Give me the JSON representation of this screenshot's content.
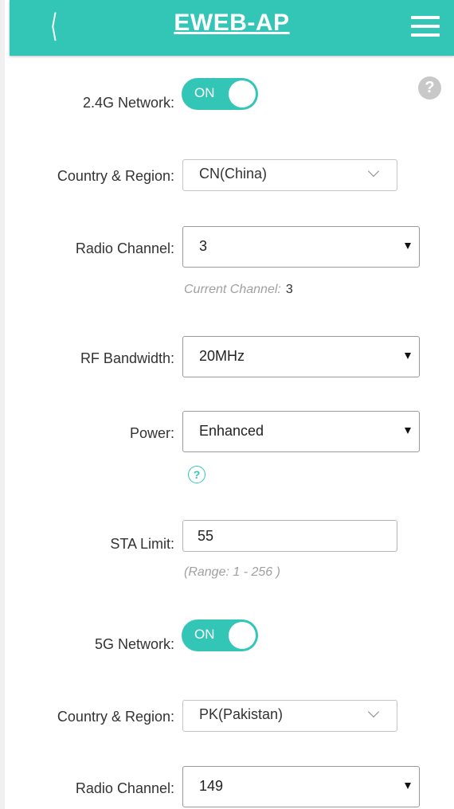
{
  "header": {
    "back_icon": "chevron-left-icon",
    "back_glyph": "⟨",
    "title": "EWEB-AP",
    "menu_icon": "hamburger-menu-icon"
  },
  "colors": {
    "accent": "#33c6b7",
    "help_gray": "#c8c8c8",
    "hint": "#a0a0a0"
  },
  "help_icon_glyph": "?",
  "network_24g": {
    "label": "2.4G Network:",
    "toggle": "ON",
    "country_label": "Country & Region:",
    "country_value": "CN(China)",
    "channel_label": "Radio Channel:",
    "channel_value": "3",
    "current_channel_label": "Current Channel:",
    "current_channel_value": "3",
    "bandwidth_label": "RF Bandwidth:",
    "bandwidth_value": "20MHz",
    "power_label": "Power:",
    "power_value": "Enhanced",
    "sta_label": "STA Limit:",
    "sta_value": "55",
    "sta_range": "(Range:  1 - 256 )"
  },
  "network_5g": {
    "label": "5G Network:",
    "toggle": "ON",
    "country_label": "Country & Region:",
    "country_value": "PK(Pakistan)",
    "channel_label": "Radio Channel:",
    "channel_value": "149"
  }
}
